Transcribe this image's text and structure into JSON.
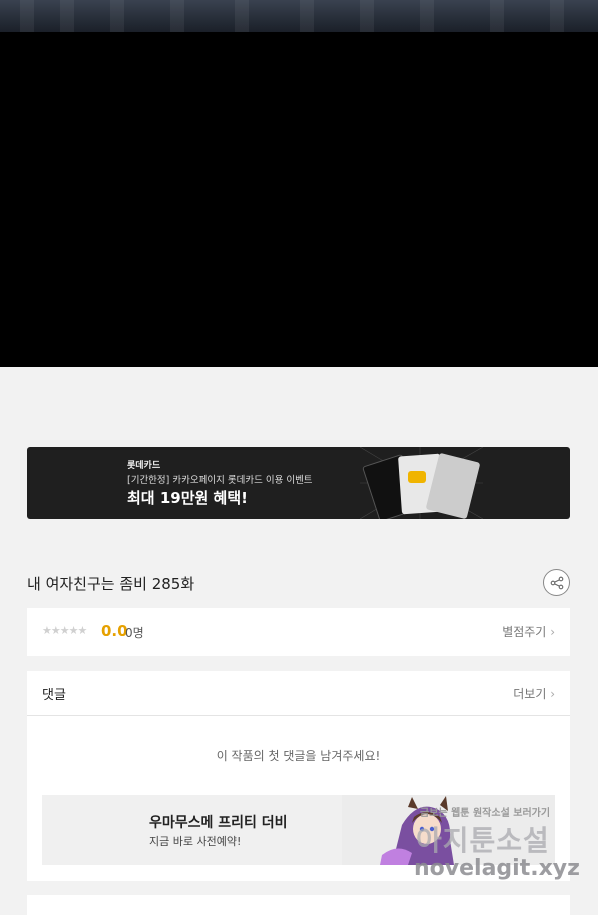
{
  "banner": {
    "brand": "롯데카드",
    "subtitle": "[기간한정] 카카오페이지 롯데카드 이용 이벤트",
    "headline": "최대 19만원 혜택!"
  },
  "episode": {
    "title": "내 여자친구는 좀비 285화",
    "share_icon": "share-icon"
  },
  "rating": {
    "stars": "★★★★★",
    "score": "0.0",
    "count": "0명",
    "rate_link": "별점주기"
  },
  "comments": {
    "title": "댓글",
    "more": "더보기",
    "empty_message": "이 작품의 첫 댓글을 남겨주세요!"
  },
  "ad": {
    "title": "우마무스메 프리티 더비",
    "subtitle": "지금 바로 사전예약!"
  },
  "watermark": {
    "top": "금보는 웹툰 원작소설 보러가기",
    "middle": "아지툰소설",
    "bottom": "novelagit.xyz"
  },
  "colors": {
    "score": "#e6a100",
    "page_bg": "#f2f2f2"
  }
}
